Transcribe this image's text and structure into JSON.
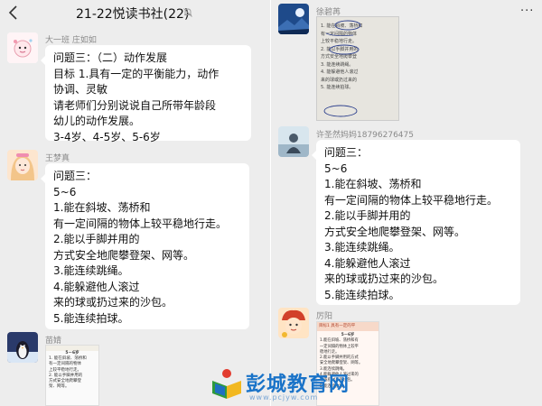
{
  "left_chat": {
    "title": "21-22悦读书社(22)",
    "messages": [
      {
        "sender": "大一班 庄如如",
        "lines": [
          "问题三：（二）动作发展",
          "目标 1.具有一定的平衡能力，动作",
          "协调、灵敏",
          "请老师们分别说说自己所带年龄段",
          "幼儿的动作发展。",
          "3-4岁、4-5岁、5-6岁"
        ]
      },
      {
        "sender": "王梦真",
        "lines": [
          "问题三：",
          "5~6",
          "1.能在斜坡、荡桥和",
          "有一定间隔的物体上较平稳地行走。",
          "2.能以手脚并用的",
          "方式安全地爬攀登架、网等。",
          "3.能连续跳绳。",
          "4.能躲避他人滚过",
          "来的球或扔过来的沙包。",
          "5.能连续拍球。"
        ]
      },
      {
        "sender": "苗婧",
        "image_text": [
          "5－6岁",
          "1. 能在斜坡、荡桥和",
          "有一定间隔的物体",
          "上较平稳地行走。",
          "2. 能以手脚并用的",
          "方式安全地爬攀登",
          "架、网等。"
        ]
      }
    ]
  },
  "right_chat": {
    "more_label": "···",
    "messages": [
      {
        "sender": "徐碧苒",
        "image_text": [
          "1. 能在斜坡、荡桥和",
          "有一定间隔的物体",
          "上较平稳地行走。",
          "2. 能以手脚并用的",
          "方式安全地爬攀登",
          "3. 能连续跳绳。",
          "4. 能躲避他人滚过",
          "来的球或扔过来的",
          "5. 能连续拍球。"
        ]
      },
      {
        "sender": "许圣然妈妈18796276475",
        "lines": [
          "问题三：",
          "5~6",
          "1.能在斜坡、荡桥和",
          "有一定间隔的物体上较平稳地行走。",
          "2.能以手脚并用的",
          "方式安全地爬攀登架、网等。",
          "3.能连续跳绳。",
          "4.能躲避他人滚过",
          "来的球或扔过来的沙包。",
          "5.能连续拍球。"
        ]
      },
      {
        "sender": "厉阳",
        "image_text": [
          "目标1 具有一定的平",
          "5－6岁",
          "1.能在斜坡、荡桥和有",
          "一定间隔的物体上较平",
          "稳地行走。",
          "2.能以手脚并用的方式",
          "安全地爬攀登架、网等。",
          "3.能连续跳绳。",
          "4.能躲避他人滚过来的",
          "球或扔过来的沙包。",
          "5.能连续拍球。"
        ]
      }
    ]
  },
  "watermark": {
    "text": "彭城教育网",
    "url": "www.pcjyw.com"
  },
  "colors": {
    "background": "#ededed",
    "bubble": "#ffffff",
    "name": "#8a8a8a",
    "watermark": "#1a73c8"
  }
}
